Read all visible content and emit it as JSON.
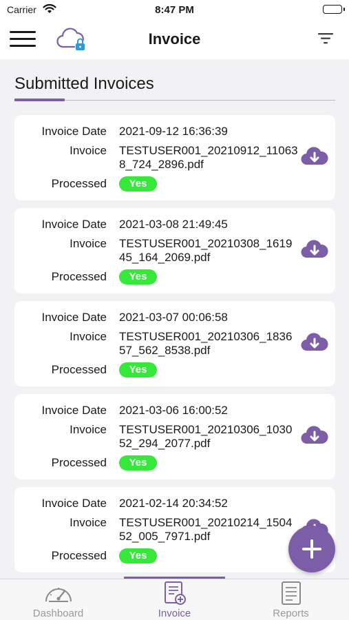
{
  "status_bar": {
    "carrier": "Carrier",
    "time": "8:47 PM"
  },
  "navbar": {
    "title": "Invoice",
    "icons": [
      "menu-icon",
      "cloud-lock-icon",
      "filter-icon"
    ]
  },
  "section": {
    "title": "Submitted Invoices"
  },
  "labels": {
    "date": "Invoice Date",
    "invoice": "Invoice",
    "processed": "Processed"
  },
  "invoices": [
    {
      "date": "2021-09-12 16:36:39",
      "file": "TESTUSER001_20210912_110638_724_2896.pdf",
      "processed": "Yes"
    },
    {
      "date": "2021-03-08 21:49:45",
      "file": "TESTUSER001_20210308_161945_164_2069.pdf",
      "processed": "Yes"
    },
    {
      "date": "2021-03-07 00:06:58",
      "file": "TESTUSER001_20210306_183657_562_8538.pdf",
      "processed": "Yes"
    },
    {
      "date": "2021-03-06 16:00:52",
      "file": "TESTUSER001_20210306_103052_294_2077.pdf",
      "processed": "Yes"
    },
    {
      "date": "2021-02-14 20:34:52",
      "file": "TESTUSER001_20210214_150452_005_7971.pdf",
      "processed": "Yes"
    }
  ],
  "tabs": [
    {
      "label": "Dashboard",
      "icon": "speedometer-icon"
    },
    {
      "label": "Invoice",
      "icon": "invoice-add-icon"
    },
    {
      "label": "Reports",
      "icon": "report-icon"
    }
  ],
  "colors": {
    "accent": "#7b5ea7",
    "badge": "#35e83a"
  }
}
